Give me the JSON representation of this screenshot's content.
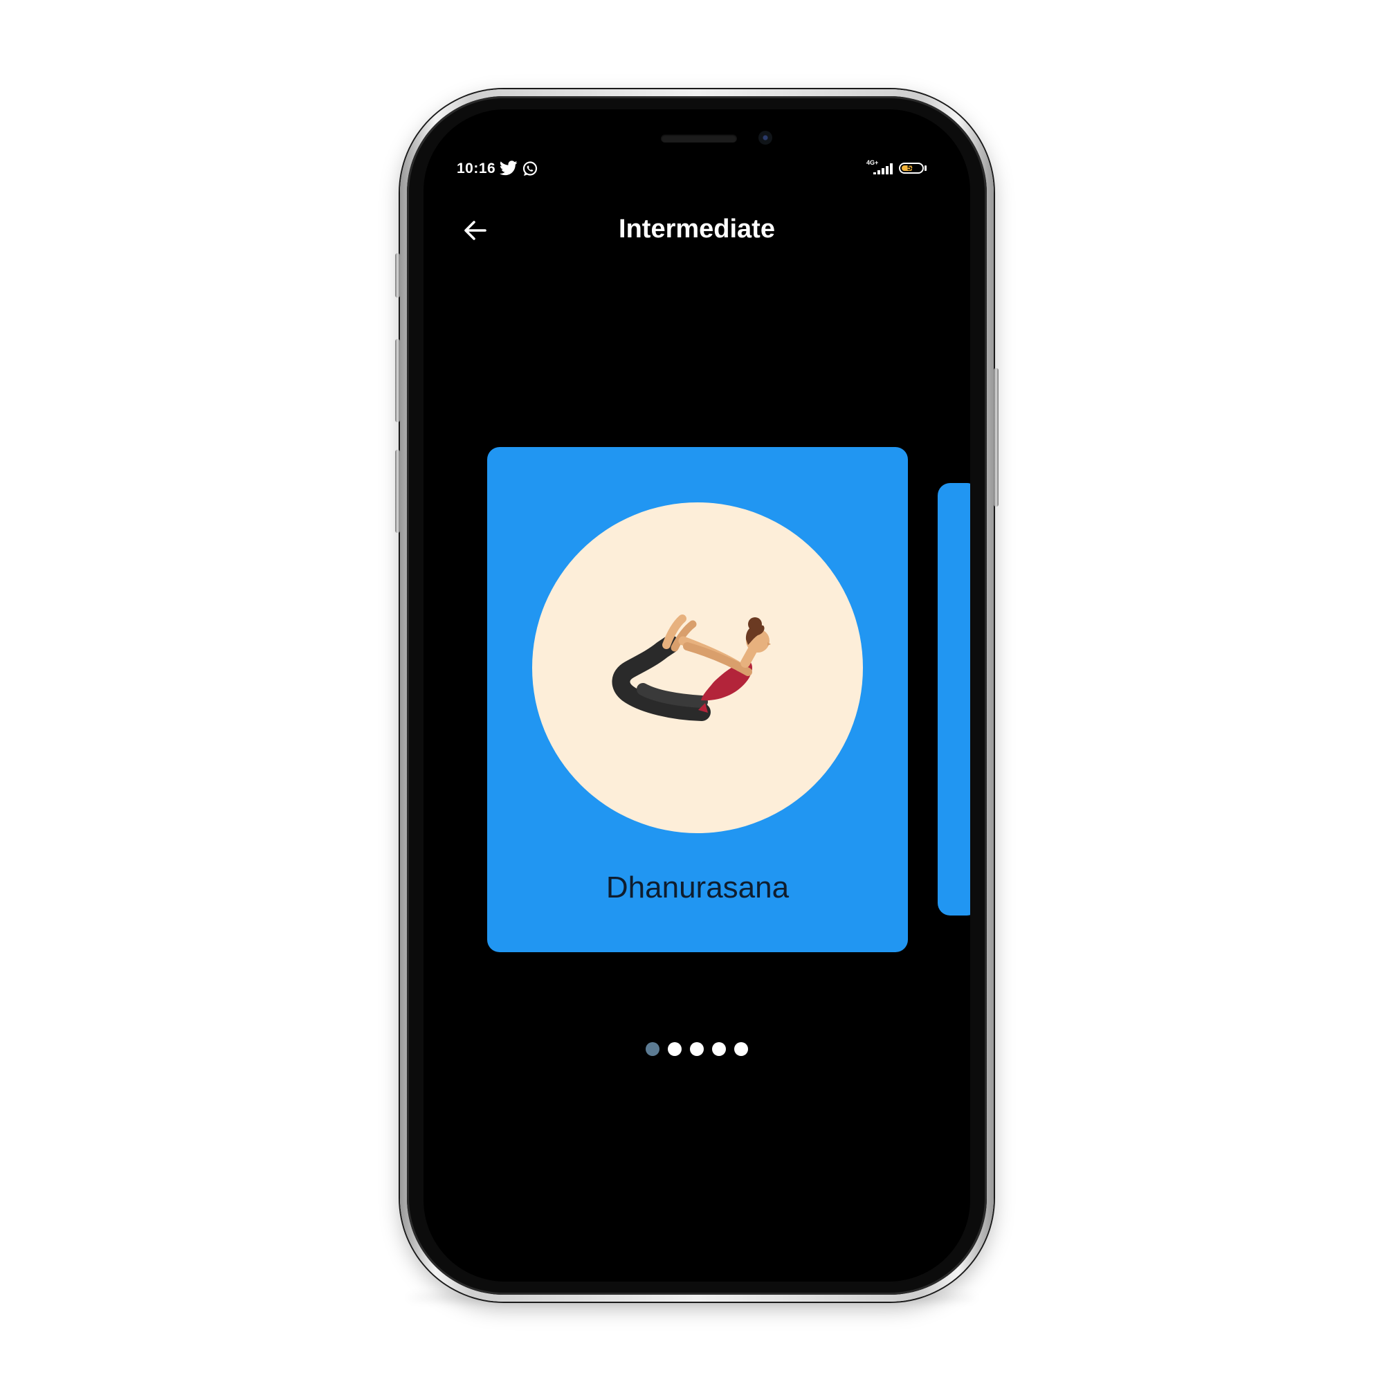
{
  "status_bar": {
    "time": "10:16",
    "notification_icons": [
      "twitter-icon",
      "whatsapp-icon"
    ],
    "network": "4G+",
    "battery_level": "58",
    "battery_fraction": 0.58
  },
  "header": {
    "title": "Intermediate",
    "back_icon": "arrow-left-icon"
  },
  "carousel": {
    "current_index": 0,
    "total": 5,
    "cards": [
      {
        "name": "Dhanurasana",
        "illustration": "bow-pose-figure"
      }
    ]
  },
  "colors": {
    "card": "#2196f2",
    "circle": "#fdeed9",
    "screen_bg": "#000000",
    "dot_active": "#5c7b93",
    "dot_inactive": "#ffffff",
    "title_text": "#ffffff",
    "card_text": "#0f1d2e"
  }
}
